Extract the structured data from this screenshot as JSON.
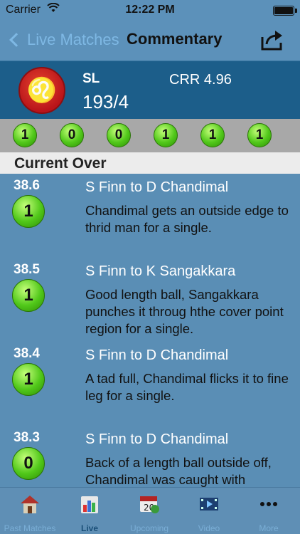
{
  "status_bar": {
    "carrier": "Carrier",
    "time": "12:22 PM"
  },
  "nav": {
    "back_label": "Live Matches",
    "title": "Commentary"
  },
  "score": {
    "team": "SL",
    "runs_wickets": "193/4",
    "crr": "CRR 4.96"
  },
  "over_strip": [
    "1",
    "0",
    "0",
    "1",
    "1",
    "1"
  ],
  "section_title": "Current Over",
  "commentary": [
    {
      "over": "38.6",
      "runs": "1",
      "header": "S Finn to D Chandimal",
      "text": "Chandimal gets an outside edge to thrid man for a single."
    },
    {
      "over": "38.5",
      "runs": "1",
      "header": "S Finn to K Sangakkara",
      "text": "Good length ball, Sangakkara punches it throug hthe cover point region for a single."
    },
    {
      "over": "38.4",
      "runs": "1",
      "header": "S Finn to D Chandimal",
      "text": "A tad full, Chandimal flicks it to fine leg for a single."
    },
    {
      "over": "38.3",
      "runs": "0",
      "header": "S Finn to D Chandimal",
      "text": "Back of a length ball outside off, Chandimal was caught with"
    }
  ],
  "tabs": [
    {
      "label": "Past Matches",
      "icon": "house-icon",
      "active": false
    },
    {
      "label": "Live",
      "icon": "bar-chart-icon",
      "active": true
    },
    {
      "label": "Upcoming",
      "icon": "calendar-icon",
      "active": false
    },
    {
      "label": "Video",
      "icon": "film-icon",
      "active": false
    },
    {
      "label": "More",
      "icon": "more-dots-icon",
      "active": false
    }
  ],
  "colors": {
    "ball_green": "#51c81a",
    "header_blue": "#1c5e8a",
    "background": "#5a8eb5"
  }
}
